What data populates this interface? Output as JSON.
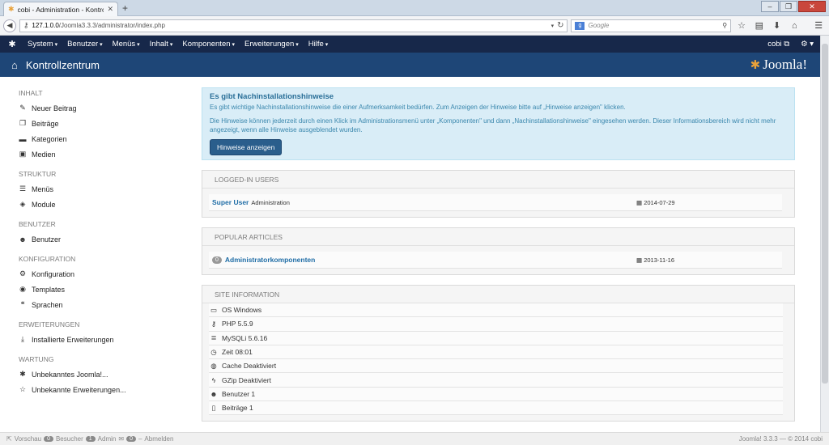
{
  "browser": {
    "tab_title": "cobi - Administration - Kontro...",
    "url_host": "127.1.0.0",
    "url_path": "/Joomla3.3.3/administrator/index.php",
    "search_placeholder": "Google"
  },
  "topnav": {
    "items": [
      "System",
      "Benutzer",
      "Menüs",
      "Inhalt",
      "Komponenten",
      "Erweiterungen",
      "Hilfe"
    ],
    "user": "cobi"
  },
  "header": {
    "title": "Kontrollzentrum",
    "brand": "Joomla!"
  },
  "sidebar": {
    "sections": [
      {
        "title": "INHALT",
        "items": [
          {
            "label": "Neuer Beitrag",
            "icon": "pencil-icon"
          },
          {
            "label": "Beiträge",
            "icon": "copy-icon"
          },
          {
            "label": "Kategorien",
            "icon": "folder-icon"
          },
          {
            "label": "Medien",
            "icon": "picture-icon"
          }
        ]
      },
      {
        "title": "STRUKTUR",
        "items": [
          {
            "label": "Menüs",
            "icon": "list-icon"
          },
          {
            "label": "Module",
            "icon": "cube-icon"
          }
        ]
      },
      {
        "title": "BENUTZER",
        "items": [
          {
            "label": "Benutzer",
            "icon": "user-icon"
          }
        ]
      },
      {
        "title": "KONFIGURATION",
        "items": [
          {
            "label": "Konfiguration",
            "icon": "gear-icon"
          },
          {
            "label": "Templates",
            "icon": "eye-icon"
          },
          {
            "label": "Sprachen",
            "icon": "comment-icon"
          }
        ]
      },
      {
        "title": "ERWEITERUNGEN",
        "items": [
          {
            "label": "Installierte Erweiterungen",
            "icon": "download-icon"
          }
        ]
      },
      {
        "title": "WARTUNG",
        "items": [
          {
            "label": "Unbekanntes Joomla!...",
            "icon": "joomla-icon"
          },
          {
            "label": "Unbekannte Erweiterungen...",
            "icon": "star-icon"
          }
        ]
      }
    ]
  },
  "alert": {
    "title": "Es gibt Nachinstallationshinweise",
    "text1": "Es gibt wichtige Nachinstallationshinweise die einer Aufmerksamkeit bedürfen. Zum Anzeigen der Hinweise bitte auf „Hinweise anzeigen\" klicken.",
    "text2": "Die Hinweise können jederzeit durch einen Klick im Administrationsmenü unter „Komponenten\" und dann „Nachinstallationshinweise\" eingesehen werden. Dieser Informationsbereich wird nicht mehr angezeigt, wenn alle Hinweise ausgeblendet wurden.",
    "button": "Hinweise anzeigen"
  },
  "logged_in": {
    "title": "LOGGED-IN USERS",
    "user": "Super User",
    "role": "Administration",
    "date": "2014-07-29"
  },
  "popular": {
    "title": "POPULAR ARTICLES",
    "hits": "0",
    "article": "Administratorkomponenten",
    "date": "2013-11-16"
  },
  "siteinfo": {
    "title": "SITE INFORMATION",
    "rows": [
      {
        "icon": "monitor-icon",
        "text": "OS Windows"
      },
      {
        "icon": "key-icon",
        "text": "PHP 5.5.9"
      },
      {
        "icon": "database-icon",
        "text": "MySQLi 5.6.16"
      },
      {
        "icon": "clock-icon",
        "text": "Zeit 08:01"
      },
      {
        "icon": "cache-icon",
        "text": "Cache Deaktiviert"
      },
      {
        "icon": "bolt-icon",
        "text": "GZip Deaktiviert"
      },
      {
        "icon": "user-icon",
        "text": "Benutzer 1"
      },
      {
        "icon": "file-icon",
        "text": "Beiträge 1"
      }
    ]
  },
  "footer": {
    "preview": "Vorschau",
    "visitors_count": "0",
    "visitors": "Besucher",
    "admin_count": "1",
    "admin": "Admin",
    "msg_count": "0",
    "logout": "Abmelden",
    "version": "Joomla! 3.3.3 — © 2014 cobi"
  }
}
